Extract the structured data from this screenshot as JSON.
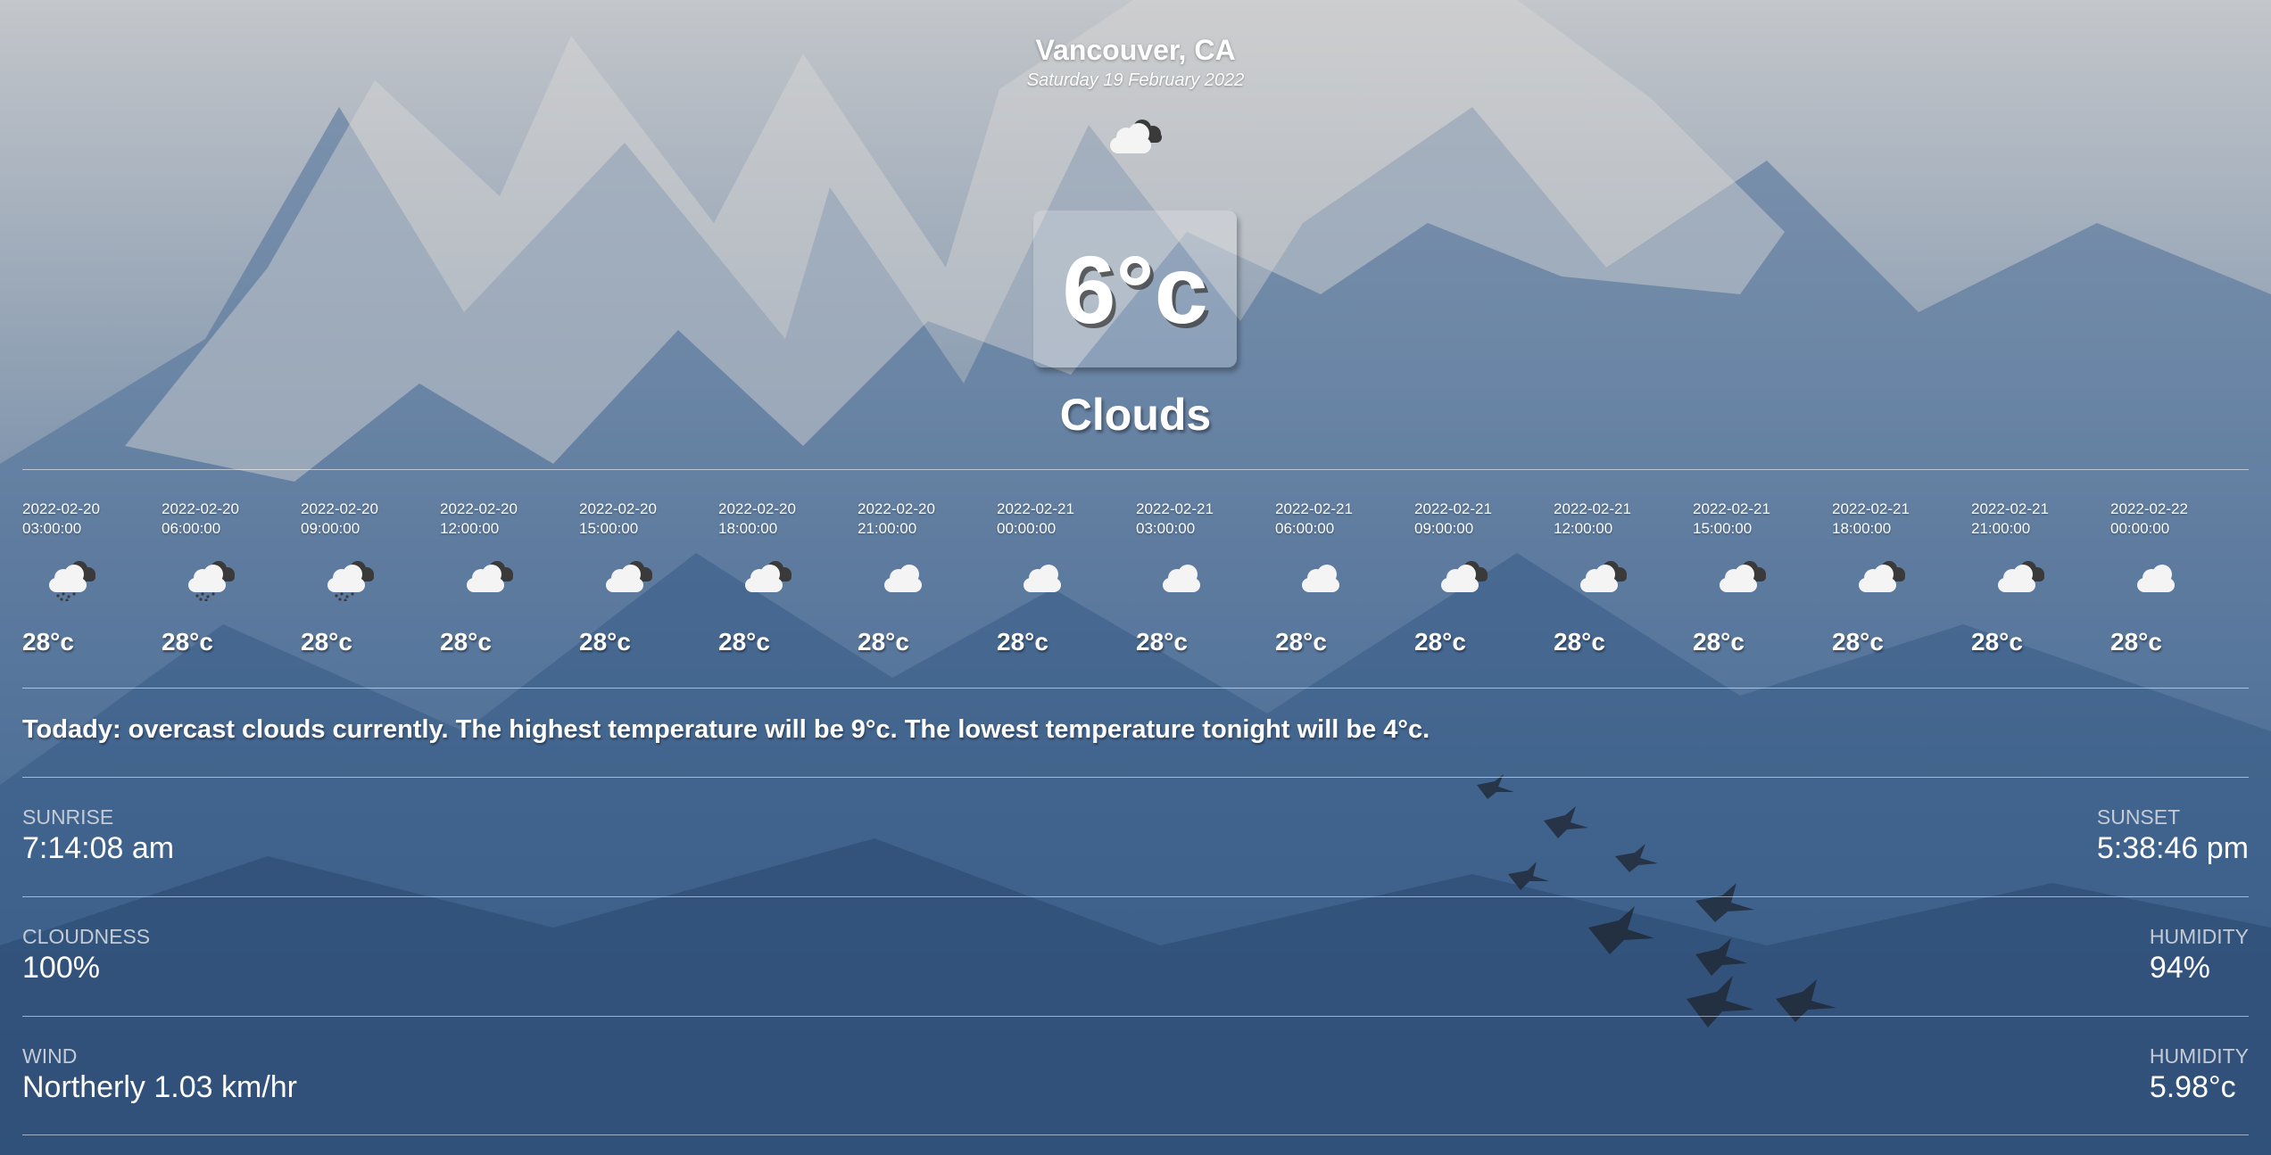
{
  "location": {
    "city": "Vancouver, CA",
    "date": "Saturday 19 February 2022"
  },
  "current": {
    "icon": "cloud-icon",
    "temperature": "6°c",
    "condition": "Clouds"
  },
  "forecast": [
    {
      "date": "2022-02-20",
      "time": "03:00:00",
      "icon": "rain-cloud-icon",
      "temp": "28°c"
    },
    {
      "date": "2022-02-20",
      "time": "06:00:00",
      "icon": "rain-cloud-icon",
      "temp": "28°c"
    },
    {
      "date": "2022-02-20",
      "time": "09:00:00",
      "icon": "rain-cloud-icon",
      "temp": "28°c"
    },
    {
      "date": "2022-02-20",
      "time": "12:00:00",
      "icon": "broken-clouds-icon",
      "temp": "28°c"
    },
    {
      "date": "2022-02-20",
      "time": "15:00:00",
      "icon": "broken-clouds-icon",
      "temp": "28°c"
    },
    {
      "date": "2022-02-20",
      "time": "18:00:00",
      "icon": "broken-clouds-icon",
      "temp": "28°c"
    },
    {
      "date": "2022-02-20",
      "time": "21:00:00",
      "icon": "cloud-icon",
      "temp": "28°c"
    },
    {
      "date": "2022-02-21",
      "time": "00:00:00",
      "icon": "cloud-icon",
      "temp": "28°c"
    },
    {
      "date": "2022-02-21",
      "time": "03:00:00",
      "icon": "cloud-icon",
      "temp": "28°c"
    },
    {
      "date": "2022-02-21",
      "time": "06:00:00",
      "icon": "cloud-icon",
      "temp": "28°c"
    },
    {
      "date": "2022-02-21",
      "time": "09:00:00",
      "icon": "broken-clouds-icon",
      "temp": "28°c"
    },
    {
      "date": "2022-02-21",
      "time": "12:00:00",
      "icon": "broken-clouds-icon",
      "temp": "28°c"
    },
    {
      "date": "2022-02-21",
      "time": "15:00:00",
      "icon": "broken-clouds-icon",
      "temp": "28°c"
    },
    {
      "date": "2022-02-21",
      "time": "18:00:00",
      "icon": "broken-clouds-icon",
      "temp": "28°c"
    },
    {
      "date": "2022-02-21",
      "time": "21:00:00",
      "icon": "broken-clouds-icon",
      "temp": "28°c"
    },
    {
      "date": "2022-02-22",
      "time": "00:00:00",
      "icon": "cloud-icon",
      "temp": "28°c"
    }
  ],
  "summary": "Todady: overcast clouds currently. The highest temperature will be 9°c. The lowest temperature tonight will be 4°c.",
  "details": {
    "sunrise": {
      "label": "SUNRISE",
      "value": "7:14:08 am"
    },
    "sunset": {
      "label": "SUNSET",
      "value": "5:38:46 pm"
    },
    "cloudiness": {
      "label": "CLOUDNESS",
      "value": "100%"
    },
    "humidity": {
      "label": "HUMIDITY",
      "value": "94%"
    },
    "wind": {
      "label": "WIND",
      "value": "Northerly 1.03 km/hr"
    },
    "humidity2": {
      "label": "HUMIDITY",
      "value": "5.98°c"
    }
  }
}
